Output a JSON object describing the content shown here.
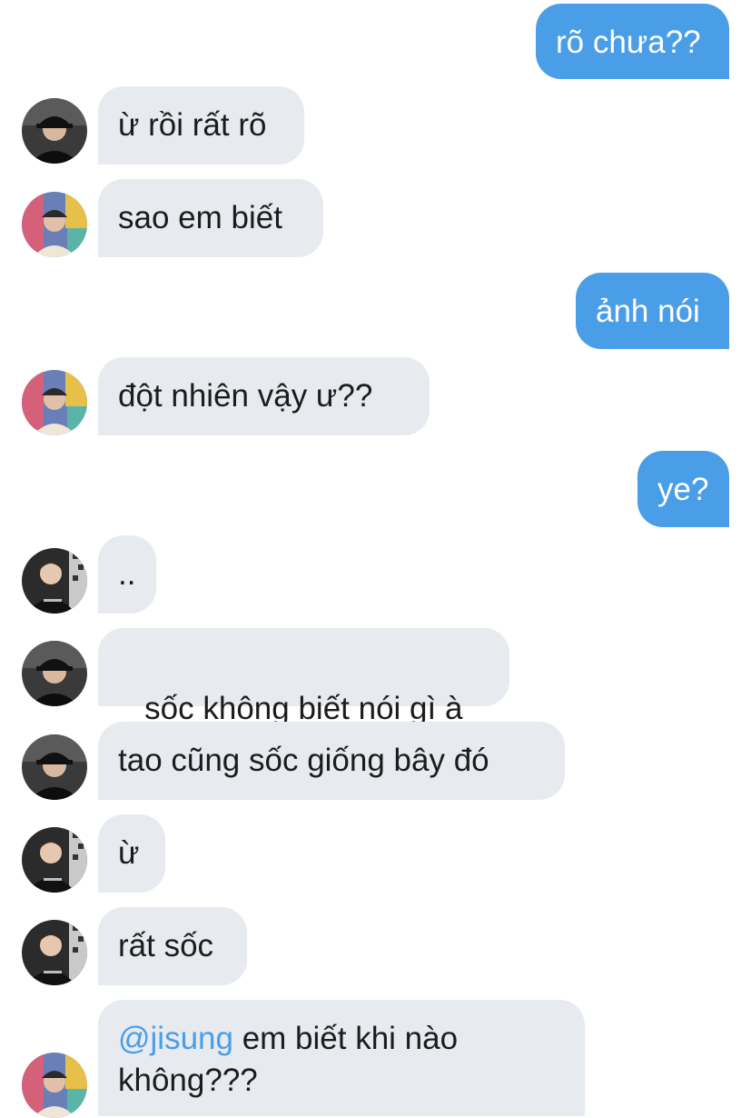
{
  "messages": [
    {
      "from": "me",
      "text": "rõ chưa??"
    },
    {
      "from": "friend_a",
      "text": "ừ rồi rất rõ"
    },
    {
      "from": "friend_b",
      "text": "sao em biết"
    },
    {
      "from": "me",
      "text": "ảnh nói"
    },
    {
      "from": "friend_b",
      "text": "đột nhiên vậy ư??"
    },
    {
      "from": "me",
      "text": "ye?"
    },
    {
      "from": "friend_c",
      "text": ".."
    },
    {
      "from": "friend_a",
      "text": " sốc không biết nói gì à"
    },
    {
      "from": "friend_a",
      "text": "tao cũng sốc giống bây đó"
    },
    {
      "from": "friend_c",
      "text": "ừ"
    },
    {
      "from": "friend_c",
      "text": "rất sốc"
    },
    {
      "from": "friend_b",
      "mention": "@jisung",
      "text": " em biết khi nào không???"
    }
  ],
  "colors": {
    "outgoing_bubble": "#4a9ee8",
    "incoming_bubble": "#e7eaee",
    "mention": "#4a9ee8"
  }
}
